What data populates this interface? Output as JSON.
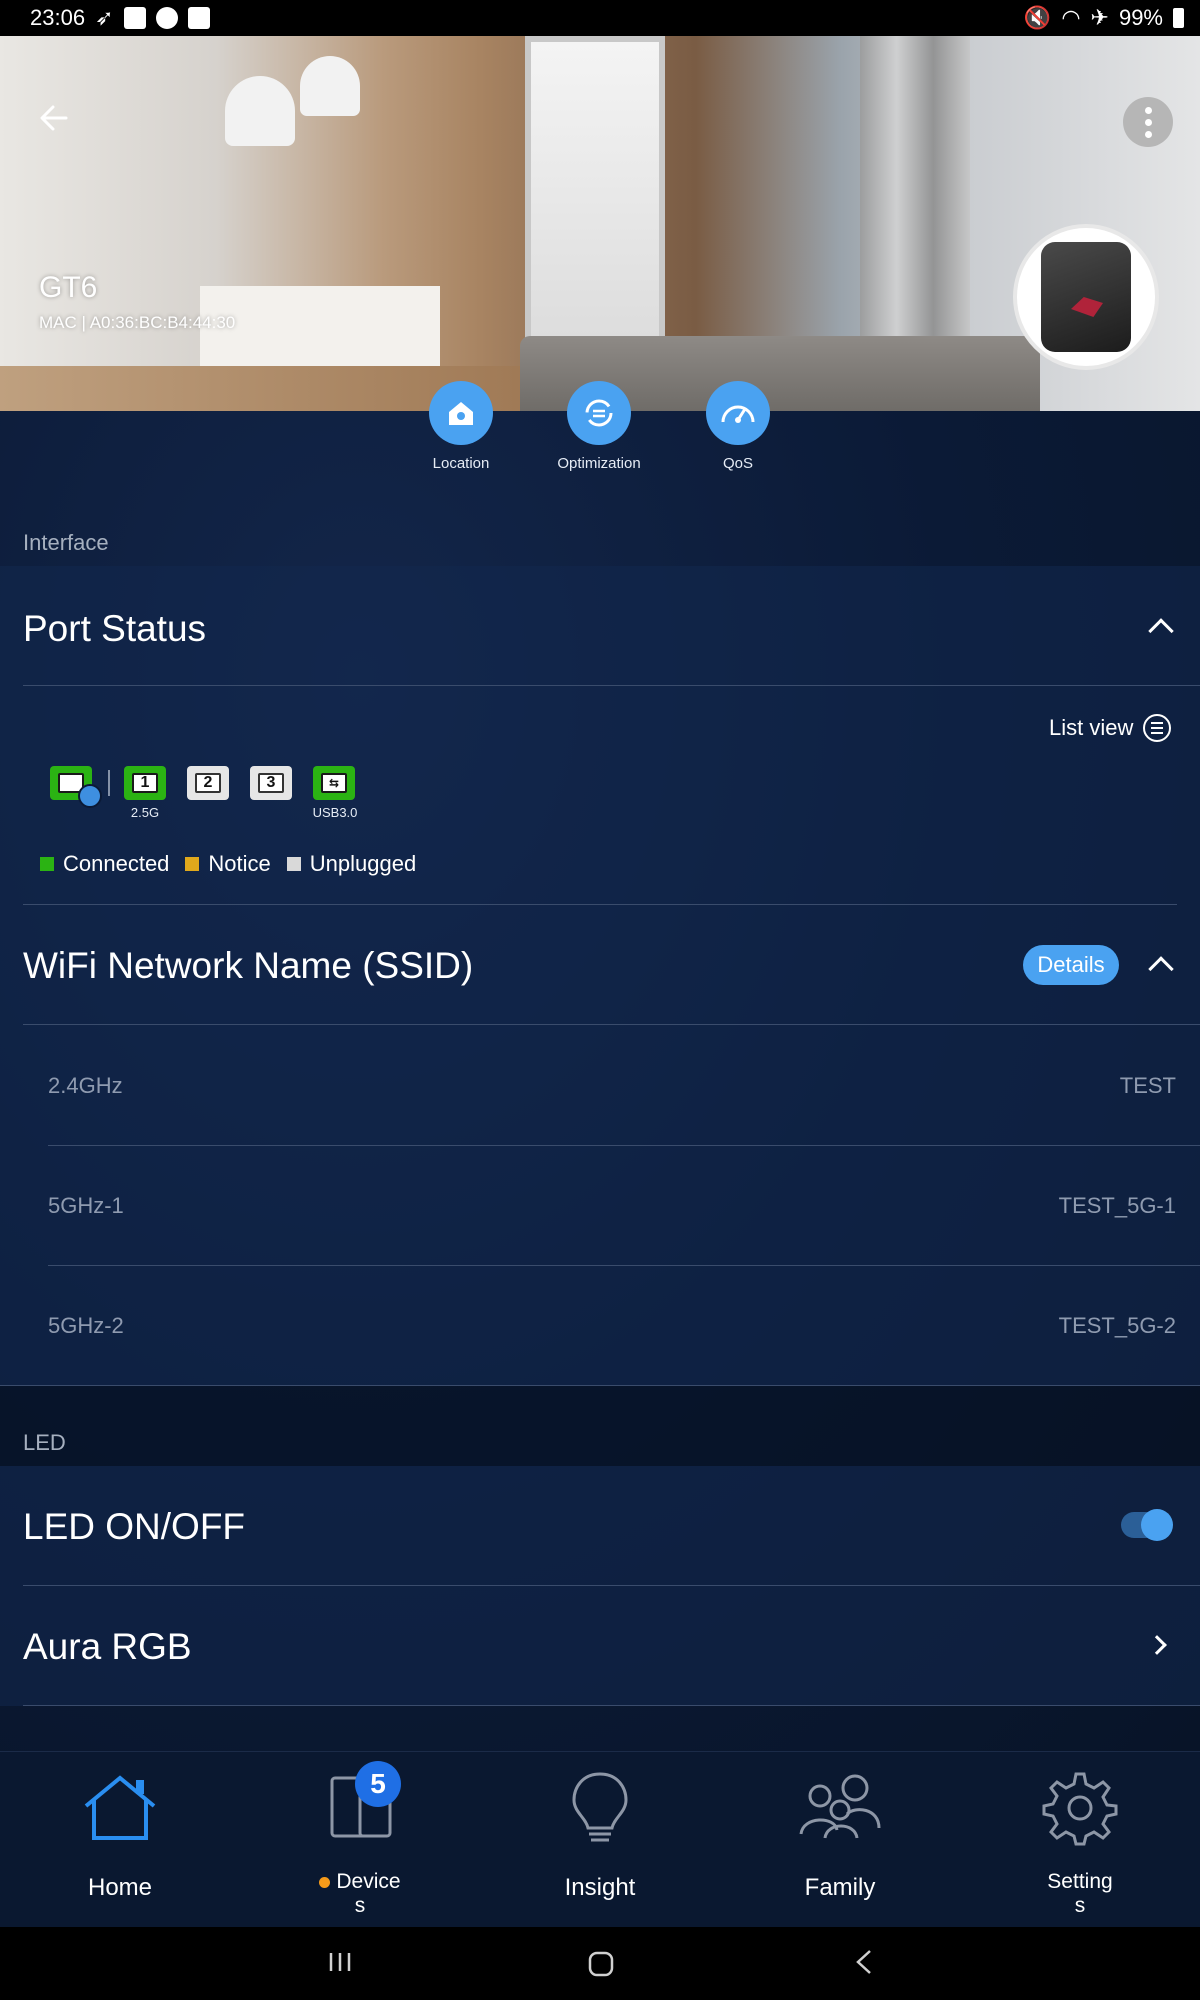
{
  "status_bar": {
    "time": "23:06",
    "battery": "99%"
  },
  "header": {
    "device_name": "GT6",
    "mac_line": "MAC  |  A0:36:BC:B4:44:30"
  },
  "quick_actions": [
    {
      "label": "Location",
      "icon": "home-location-icon"
    },
    {
      "label": "Optimization",
      "icon": "optimization-icon"
    },
    {
      "label": "QoS",
      "icon": "speedometer-icon"
    }
  ],
  "interface_section": {
    "label": "Interface",
    "port_status": {
      "title": "Port Status",
      "list_view_label": "List view",
      "ports": [
        {
          "name": "WAN",
          "status": "Connected",
          "sub": ""
        },
        {
          "name": "1",
          "status": "Connected",
          "sub": "2.5G"
        },
        {
          "name": "2",
          "status": "Unplugged",
          "sub": ""
        },
        {
          "name": "3",
          "status": "Unplugged",
          "sub": ""
        },
        {
          "name": "USB",
          "status": "Connected",
          "sub": "USB3.0"
        }
      ],
      "legend": [
        {
          "label": "Connected",
          "color": "#2bb313"
        },
        {
          "label": "Notice",
          "color": "#e0a81c"
        },
        {
          "label": "Unplugged",
          "color": "#d9d9d9"
        }
      ]
    },
    "wifi": {
      "title": "WiFi Network Name (SSID)",
      "details_label": "Details",
      "bands": [
        {
          "band": "2.4GHz",
          "ssid": "TEST"
        },
        {
          "band": "5GHz-1",
          "ssid": "TEST_5G-1"
        },
        {
          "band": "5GHz-2",
          "ssid": "TEST_5G-2"
        }
      ]
    }
  },
  "led_section": {
    "label": "LED",
    "led_toggle_label": "LED ON/OFF",
    "led_on": true,
    "aura_label": "Aura RGB"
  },
  "bottom_nav": {
    "home": "Home",
    "devices_line1": "Device",
    "devices_line2": "s",
    "devices_badge": "5",
    "insight": "Insight",
    "family": "Family",
    "settings_line1": "Setting",
    "settings_line2": "s"
  },
  "colors": {
    "accent": "#4aa2f1",
    "active_nav": "#2a8ef0",
    "connected": "#2bb313",
    "notice": "#e0a81c",
    "unplugged": "#d9d9d9"
  }
}
